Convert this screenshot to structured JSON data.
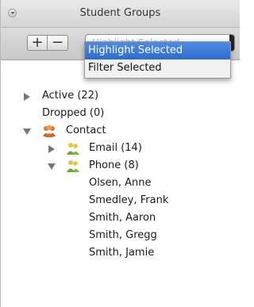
{
  "panel": {
    "title": "Student Groups"
  },
  "toolbar": {
    "add_label": "+",
    "remove_label": "−",
    "select_value": "Highlight Selected"
  },
  "dropdown": {
    "options": [
      "Highlight Selected",
      "Filter Selected"
    ],
    "selected_index": 0
  },
  "tree": {
    "active": "Active (22)",
    "dropped": "Dropped (0)",
    "contact": "Contact",
    "email": "Email (14)",
    "phone": "Phone (8)",
    "students": [
      "Olsen, Anne",
      "Smedley, Frank",
      "Smith, Aaron",
      "Smith, Gregg",
      "Smith, Jamie"
    ]
  },
  "colors": {
    "selection": "#3b7ddd",
    "contact_icon": "#e07a2e",
    "group_icon": "#7fb83a"
  },
  "icons": {
    "contact": "people-group-icon",
    "email": "people-group-icon",
    "phone": "people-group-icon"
  }
}
